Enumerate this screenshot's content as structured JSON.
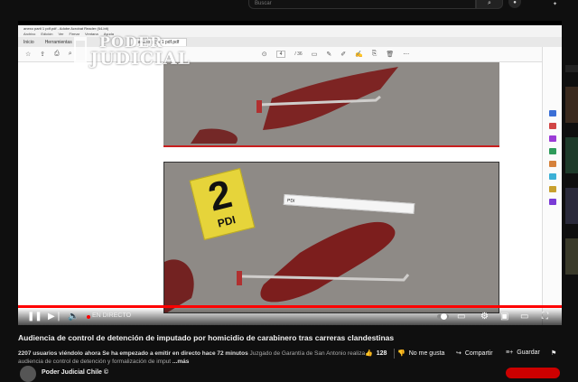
{
  "search": {
    "placeholder": "Buscar",
    "button_icon": "search-icon",
    "mic_icon": "mic-icon"
  },
  "pdf": {
    "window_title": "anexo parti 1 pdf.pdf - Adobe Acrobat Reader (64-bit)",
    "menu": [
      "Archivo",
      "Edición",
      "Ver",
      "Firmar",
      "Ventana",
      "Ayuda"
    ],
    "tabs": {
      "home": "Inicio",
      "tools": "Herramientas",
      "doc": "anexo parti 1 pdf.pdf"
    },
    "page_current": "4",
    "page_total": "/ 36",
    "ruler_text": "PDI"
  },
  "watermark": {
    "line1": "PODER",
    "line2": "JUDICIAL"
  },
  "evidence": {
    "number": "2",
    "tag": "PDI"
  },
  "player": {
    "live_label": "EN DIRECTO",
    "progress": 1.0
  },
  "video": {
    "title": "Audiencia de control de detención de imputado por homicidio de carabinero tras carreras clandestinas",
    "viewers": "2207 usuarios viéndolo ahora",
    "started": "Se ha empezado a emitir en directo hace 72 minutos",
    "description": "Juzgado de Garantía de San Antonio realiza audiencia de control de detención y formalización de imput",
    "more": "...más",
    "likes": "128",
    "dislike_label": "No me gusta",
    "share_label": "Compartir",
    "save_label": "Guardar"
  },
  "channel": {
    "name": "Poder Judicial Chile ©"
  },
  "colors": {
    "live_red": "#ff0000",
    "marker_yellow": "#e6d43a"
  }
}
